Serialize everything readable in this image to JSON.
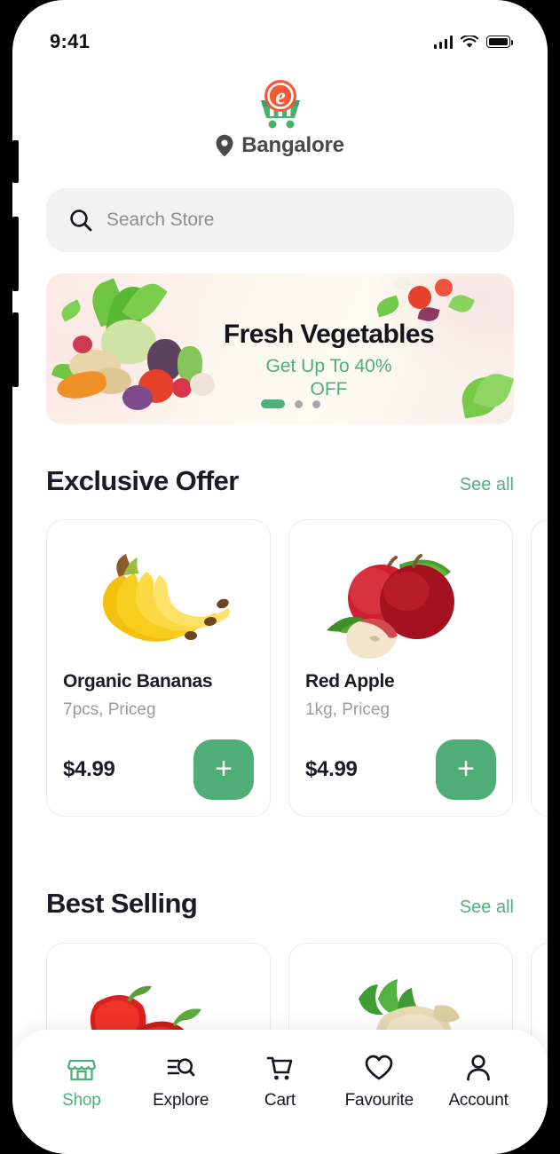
{
  "theme": {
    "accent_green": "#4FB07A",
    "button_green": "#4FAE76",
    "text_dark": "#1B1B25",
    "text_muted": "#9A9A9F",
    "search_bg": "#F2F2F2"
  },
  "status_bar": {
    "time": "9:41",
    "signal_icon": "signal-bars-icon",
    "wifi_icon": "wifi-icon",
    "battery_icon": "battery-full-icon"
  },
  "header": {
    "logo_name": "app-logo",
    "logo_letter": "e",
    "location_icon": "location-pin-icon",
    "location": "Bangalore"
  },
  "search": {
    "icon": "search-icon",
    "placeholder": "Search Store",
    "value": ""
  },
  "banner": {
    "title": "Fresh Vegetables",
    "subtitle": "Get Up To 40%\nOFF",
    "subtitle_line1": "Get Up To 40%",
    "subtitle_line2": "OFF",
    "dots_total": 3,
    "active_dot": 1
  },
  "sections": [
    {
      "title": "Exclusive Offer",
      "see_all": "See all",
      "products": [
        {
          "name": "Organic Bananas",
          "qty": "7pcs, Priceg",
          "price": "$4.99",
          "image": "bananas-image",
          "add_label": "+"
        },
        {
          "name": "Red Apple",
          "qty": "1kg, Priceg",
          "price": "$4.99",
          "image": "red-apple-image",
          "add_label": "+"
        },
        {
          "name": "",
          "qty": "",
          "price": "",
          "image": "partial-product-image",
          "add_label": "+"
        }
      ]
    },
    {
      "title": "Best Selling",
      "see_all": "See all",
      "products": [
        {
          "name": "",
          "qty": "",
          "price": "",
          "image": "red-bell-pepper-image",
          "add_label": "+"
        },
        {
          "name": "",
          "qty": "",
          "price": "",
          "image": "ginger-image",
          "add_label": "+"
        },
        {
          "name": "",
          "qty": "",
          "price": "",
          "image": "partial-product-image",
          "add_label": "+"
        }
      ]
    }
  ],
  "bottom_nav": {
    "items": [
      {
        "label": "Shop",
        "icon": "storefront-icon",
        "active": true
      },
      {
        "label": "Explore",
        "icon": "explore-search-icon",
        "active": false
      },
      {
        "label": "Cart",
        "icon": "shopping-cart-icon",
        "active": false
      },
      {
        "label": "Favourite",
        "icon": "heart-icon",
        "active": false
      },
      {
        "label": "Account",
        "icon": "person-icon",
        "active": false
      }
    ]
  }
}
